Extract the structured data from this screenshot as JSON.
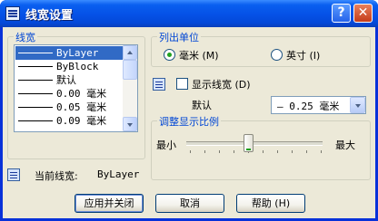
{
  "window": {
    "title": "线宽设置"
  },
  "lineweights": {
    "group_title": "线宽",
    "items": [
      {
        "label": "ByLayer",
        "selected": true
      },
      {
        "label": "ByBlock",
        "selected": false
      },
      {
        "label": "默认",
        "selected": false
      },
      {
        "label": "0.00 毫米",
        "selected": false
      },
      {
        "label": "0.05 毫米",
        "selected": false
      },
      {
        "label": "0.09 毫米",
        "selected": false
      }
    ]
  },
  "units": {
    "group_title": "列出单位",
    "millimeters_label": "毫米 (M)",
    "inches_label": "英寸 (I)",
    "selected": "millimeters"
  },
  "display": {
    "show_lineweight_label": "显示线宽 (D)",
    "show_lineweight_checked": false,
    "default_label": "默认",
    "default_value": "— 0.25 毫米"
  },
  "scale": {
    "group_title": "调整显示比例",
    "min_label": "最小",
    "max_label": "最大",
    "level": 0.43
  },
  "current": {
    "label": "当前线宽:",
    "value": "ByLayer"
  },
  "buttons": {
    "apply_close": "应用并关闭",
    "cancel": "取消",
    "help": "帮助 (H)"
  }
}
